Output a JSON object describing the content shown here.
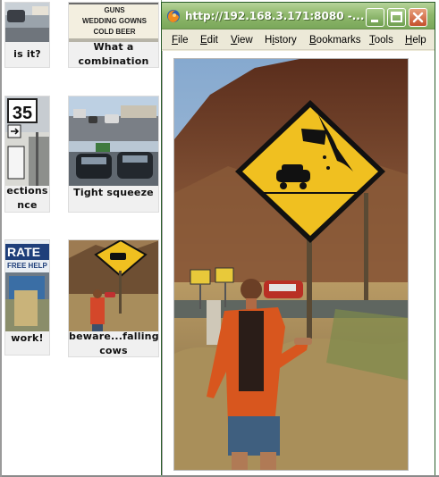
{
  "gallery": {
    "items": [
      {
        "caption_lines": [
          "is it?"
        ]
      },
      {
        "caption_lines": [
          "What a",
          "combination"
        ]
      },
      {
        "caption_lines": [
          "ections",
          "nce"
        ]
      },
      {
        "caption_lines": [
          "Tight squeeze"
        ]
      },
      {
        "caption_lines": [
          "work!"
        ]
      },
      {
        "caption_lines": [
          "beware...falling",
          "cows"
        ]
      }
    ],
    "sign_text": {
      "guns": "GUNS",
      "wedding": "WEDDING GOWNS",
      "beer": "COLD BEER",
      "route": "35",
      "rate": "RATE",
      "help": "FREE HELP"
    }
  },
  "popup": {
    "title": "http://192.168.3.171:8080 -...",
    "menu": [
      {
        "ul": "F",
        "rest": "ile"
      },
      {
        "ul": "E",
        "rest": "dit"
      },
      {
        "ul": "V",
        "rest": "iew"
      },
      {
        "ul": "",
        "rest": "History",
        "ul_index": 1
      },
      {
        "ul": "B",
        "rest": "ookmarks"
      },
      {
        "ul": "T",
        "rest": "ools"
      },
      {
        "ul": "H",
        "rest": "elp"
      }
    ],
    "colors": {
      "titlebar": "#8fb86c",
      "sign_yellow": "#f0c020",
      "close": "#c4502c"
    }
  }
}
